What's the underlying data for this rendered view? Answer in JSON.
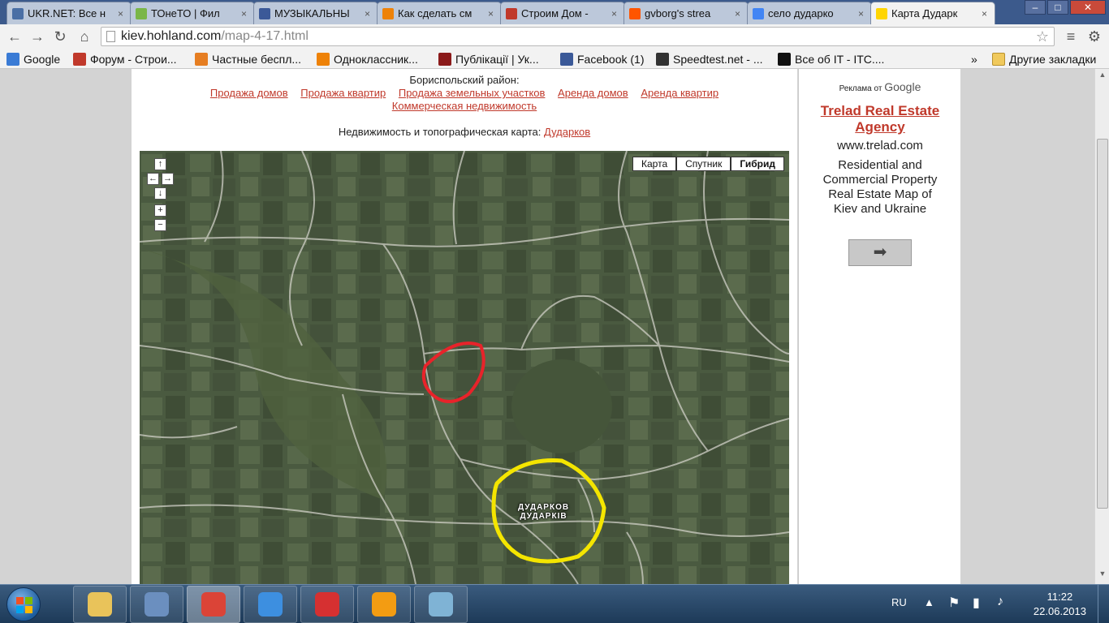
{
  "browser": {
    "tabs": [
      {
        "title": "UKR.NET: Все н",
        "favicon_color": "#4a6fa5"
      },
      {
        "title": "ТОнеТО | Фил",
        "favicon_color": "#7ab648"
      },
      {
        "title": "МУЗЫКАЛЬНЫ",
        "favicon_color": "#3b5998"
      },
      {
        "title": "Как сделать см",
        "favicon_color": "#ee8208"
      },
      {
        "title": "Строим Дом -",
        "favicon_color": "#c0392b"
      },
      {
        "title": "gvborg's strea",
        "favicon_color": "#ff5500"
      },
      {
        "title": "село дударко",
        "favicon_color": "#4285f4"
      },
      {
        "title": "Карта Дударк",
        "favicon_color": "#ffd500"
      }
    ],
    "close_symbol": "×",
    "window_controls": {
      "minimize": "–",
      "maximize": "□",
      "close": "✕"
    },
    "url_host": "kiev.hohland.com",
    "url_path": "/map-4-17.html",
    "bookmarks": [
      {
        "label": "Google",
        "icon": "google-icon",
        "color": "#3a7bd5"
      },
      {
        "label": "Форум - Строи...",
        "icon": "house-icon",
        "color": "#c0392b"
      },
      {
        "label": "Частные беспл...",
        "icon": "ball-icon",
        "color": "#e67e22"
      },
      {
        "label": "Одноклассник...",
        "icon": "ok-icon",
        "color": "#ee8208"
      },
      {
        "label": "Публікації | Ук...",
        "icon": "up-icon",
        "color": "#8b1a1a"
      },
      {
        "label": "Facebook (1)",
        "icon": "facebook-icon",
        "color": "#3b5998"
      },
      {
        "label": "Speedtest.net - ...",
        "icon": "speedtest-icon",
        "color": "#333333"
      },
      {
        "label": "Все об IT - ITC....",
        "icon": "itc-icon",
        "color": "#111111"
      }
    ],
    "bookmarks_overflow": "»",
    "other_bookmarks": "Другие закладки"
  },
  "page": {
    "district": "Бориспольский район:",
    "links": [
      "Продажа домов",
      "Продажа квартир",
      "Продажа земельных участков",
      "Аренда домов",
      "Аренда квартир",
      "Коммерческая недвижимость"
    ],
    "topo_label": "Недвижимость и топографическая карта:",
    "topo_link": "Дударков",
    "map": {
      "types": [
        "Карта",
        "Спутник",
        "Гибрид"
      ],
      "selected_type": "Гибрид",
      "nav": {
        "up": "↑",
        "left": "←",
        "right": "→",
        "down": "↓",
        "zoom_in": "+",
        "zoom_out": "−"
      },
      "village_label_ru": "ДУДАРКОВ",
      "village_label_ua": "ДУДАРКІВ",
      "annotation_colors": {
        "red": "#e8232a",
        "yellow": "#f4e500"
      }
    }
  },
  "ad": {
    "header_prefix": "Реклама от",
    "header_brand": "Google",
    "title": "Trelad Real Estate Agency",
    "url": "www.trelad.com",
    "body": "Residential and Commercial Property Real Estate Map of Kiev and Ukraine",
    "button_symbol": "➡"
  },
  "taskbar": {
    "apps": [
      {
        "name": "explorer",
        "color": "#e9c35a"
      },
      {
        "name": "app-2",
        "color": "#6b8fbf"
      },
      {
        "name": "chrome",
        "color": "#db4437"
      },
      {
        "name": "itunes",
        "color": "#3d8fe0"
      },
      {
        "name": "app-5",
        "color": "#d63031"
      },
      {
        "name": "media-player",
        "color": "#f39c12"
      },
      {
        "name": "paint",
        "color": "#7fb3d5"
      }
    ],
    "active_app": "chrome",
    "language": "RU",
    "time": "11:22",
    "date": "22.06.2013"
  }
}
